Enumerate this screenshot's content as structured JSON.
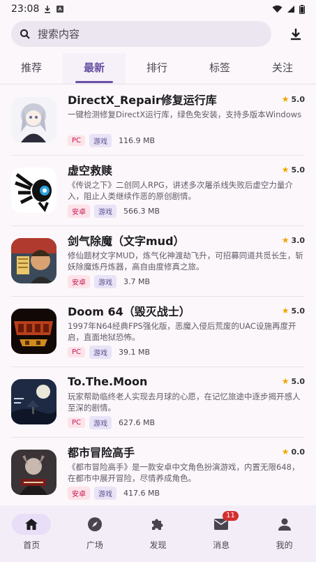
{
  "status_bar": {
    "time": "23:08"
  },
  "search": {
    "placeholder": "搜索内容"
  },
  "tabs": [
    {
      "label": "推荐"
    },
    {
      "label": "最新"
    },
    {
      "label": "排行"
    },
    {
      "label": "标签"
    },
    {
      "label": "关注"
    }
  ],
  "items": [
    {
      "title": "DirectX_Repair修复运行库",
      "rating": "5.0",
      "desc": "一键检测修复DirectX运行库，绿色免安装，支持多版本Windows",
      "platform": "PC",
      "type": "游戏",
      "size": "116.9 MB"
    },
    {
      "title": "虚空救赎",
      "rating": "5.0",
      "desc": "《传说之下》二创同人RPG，讲述多次屠杀线失败后虚空力量介入，阻止人类继续作恶的原创剧情。",
      "platform": "安卓",
      "type": "游戏",
      "size": "566.3 MB"
    },
    {
      "title": "剑气除魔（文字mud）",
      "rating": "3.0",
      "desc": "修仙题材文字MUD，炼气化神渡劫飞升，可招募同道共觅长生，斩妖除魔炼丹炼器，高自由度修真之旅。",
      "platform": "安卓",
      "type": "游戏",
      "size": "3.7 MB"
    },
    {
      "title": "Doom 64（毁灭战士）",
      "rating": "5.0",
      "desc": "1997年N64经典FPS强化版，恶魔入侵后荒废的UAC设施再度开启，直面地狱恐怖。",
      "platform": "PC",
      "type": "游戏",
      "size": "39.1 MB"
    },
    {
      "title": "To.The.Moon",
      "rating": "5.0",
      "desc": "玩家帮助临终老人实现去月球的心愿，在记忆旅途中逐步揭开感人至深的剧情。",
      "platform": "PC",
      "type": "游戏",
      "size": "627.6 MB"
    },
    {
      "title": "都市冒险高手",
      "rating": "0.0",
      "desc": "《都市冒险高手》是一款安卓中文角色扮演游戏，内置无限648，在都市中展开冒险，尽情养成角色。",
      "platform": "安卓",
      "type": "游戏",
      "size": "417.6 MB"
    }
  ],
  "bottom_nav": [
    {
      "label": "首页",
      "icon": "home-icon"
    },
    {
      "label": "广场",
      "icon": "compass-icon"
    },
    {
      "label": "发现",
      "icon": "puzzle-icon"
    },
    {
      "label": "消息",
      "icon": "mail-icon",
      "badge": "11"
    },
    {
      "label": "我的",
      "icon": "person-icon"
    }
  ],
  "colors": {
    "accent": "#6750a4",
    "star": "#f0a500",
    "badge": "#d32f2f"
  }
}
